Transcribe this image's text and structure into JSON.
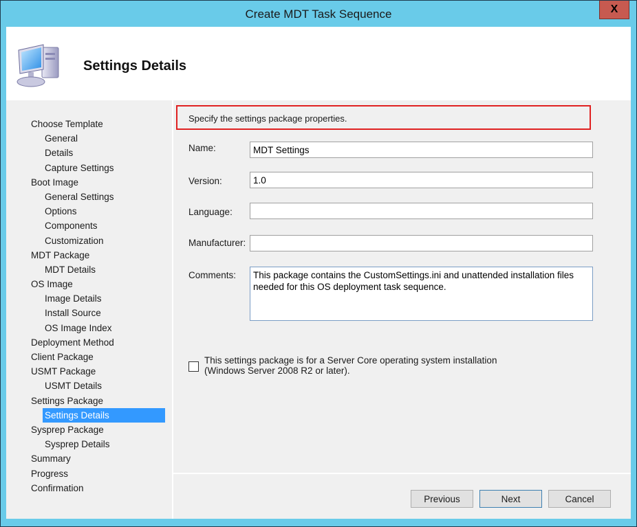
{
  "window": {
    "title": "Create MDT Task Sequence",
    "close_label": "X",
    "close_color": "#c75a50",
    "frame_color": "#69cbe9"
  },
  "header": {
    "icon": "computer-icon",
    "title": "Settings Details"
  },
  "sidebar": {
    "items": [
      {
        "label": "Choose Template",
        "level": 0
      },
      {
        "label": "General",
        "level": 1
      },
      {
        "label": "Details",
        "level": 1
      },
      {
        "label": "Capture Settings",
        "level": 1
      },
      {
        "label": "Boot Image",
        "level": 0
      },
      {
        "label": "General Settings",
        "level": 1
      },
      {
        "label": "Options",
        "level": 1
      },
      {
        "label": "Components",
        "level": 1
      },
      {
        "label": "Customization",
        "level": 1
      },
      {
        "label": "MDT Package",
        "level": 0
      },
      {
        "label": "MDT Details",
        "level": 1
      },
      {
        "label": "OS Image",
        "level": 0
      },
      {
        "label": "Image Details",
        "level": 1
      },
      {
        "label": "Install Source",
        "level": 1
      },
      {
        "label": "OS Image Index",
        "level": 1
      },
      {
        "label": "Deployment Method",
        "level": 0
      },
      {
        "label": "Client Package",
        "level": 0
      },
      {
        "label": "USMT Package",
        "level": 0
      },
      {
        "label": "USMT Details",
        "level": 1
      },
      {
        "label": "Settings Package",
        "level": 0
      },
      {
        "label": "Settings Details",
        "level": 1,
        "selected": true
      },
      {
        "label": "Sysprep Package",
        "level": 0
      },
      {
        "label": "Sysprep Details",
        "level": 1
      },
      {
        "label": "Summary",
        "level": 0
      },
      {
        "label": "Progress",
        "level": 0
      },
      {
        "label": "Confirmation",
        "level": 0
      }
    ],
    "selected_color": "#3399ff"
  },
  "main": {
    "instruction": "Specify the settings package properties.",
    "instruction_border_color": "#e02020",
    "fields": {
      "name": {
        "label": "Name:",
        "value": "MDT Settings"
      },
      "version": {
        "label": "Version:",
        "value": "1.0"
      },
      "language": {
        "label": "Language:",
        "value": ""
      },
      "manufacturer": {
        "label": "Manufacturer:",
        "value": ""
      },
      "comments": {
        "label": "Comments:",
        "value": "This package contains the CustomSettings.ini and unattended installation files needed for this OS deployment task sequence."
      }
    },
    "server_core_checkbox": {
      "label_line1": "This settings package is for a Server Core operating system installation",
      "label_line2": "(Windows Server 2008 R2 or later).",
      "checked": false
    }
  },
  "footer": {
    "previous_label": "Previous",
    "next_label": "Next",
    "cancel_label": "Cancel"
  }
}
